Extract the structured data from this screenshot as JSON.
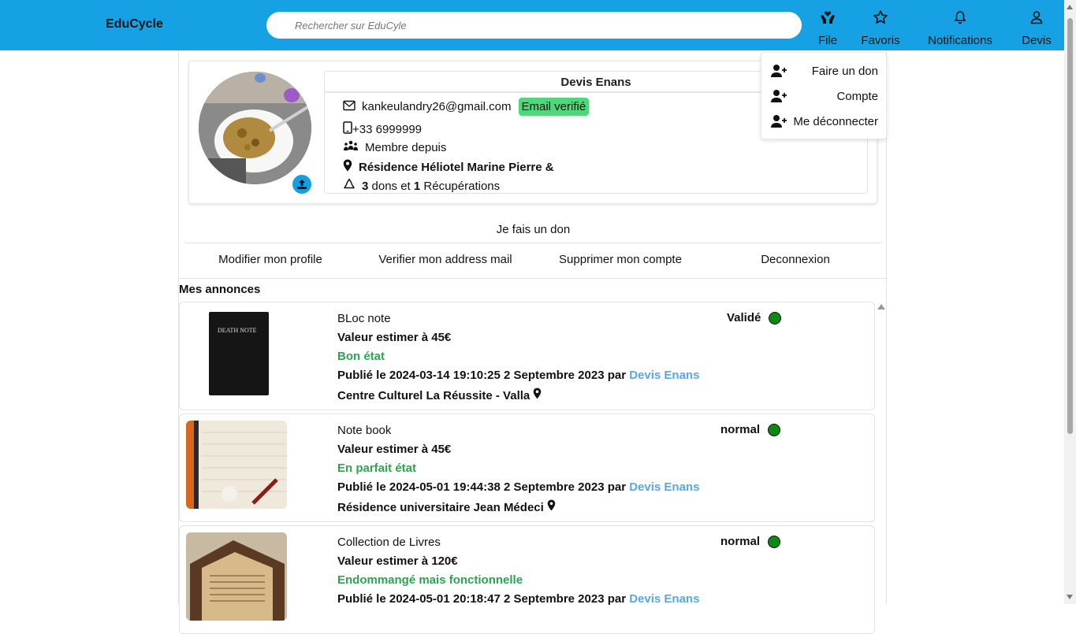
{
  "header": {
    "brand": "EduCycle",
    "search_placeholder": "Rechercher sur EduCyle",
    "nav": [
      {
        "label": "File",
        "icon": "hands-heart-icon"
      },
      {
        "label": "Favoris",
        "icon": "star-icon"
      },
      {
        "label": "Notifications",
        "icon": "bell-icon"
      },
      {
        "label": "Devis",
        "icon": "user-icon"
      }
    ]
  },
  "dropdown": {
    "items": [
      {
        "label": "Faire un don",
        "icon": "user-plus-icon"
      },
      {
        "label": "Compte",
        "icon": "user-plus-icon"
      },
      {
        "label": "Me déconnecter",
        "icon": "user-plus-icon"
      }
    ]
  },
  "profile": {
    "name": "Devis Enans",
    "email": "kankeulandry26@gmail.com",
    "email_status": "Email verifié",
    "phone": "+33  6999999",
    "member_since": "Membre depuis",
    "address": "Résidence Héliotel Marine Pierre &",
    "dons_count": "3",
    "dons_text": " dons et ",
    "recup_count": "1",
    "recup_text": " Récupérations"
  },
  "main_button": "Je fais un don",
  "actions": [
    "Modifier mon profile",
    "Verifier mon address mail",
    "Supprimer mon compte",
    "Deconnexion"
  ],
  "annonces_title": "Mes annonces",
  "annonces": [
    {
      "title": "BLoc note",
      "value": "Valeur estimer à 45€",
      "condition": "Bon état",
      "published_prefix": "Publié le 2024-03-14 19:10:25 2 Septembre 2023 par ",
      "author": "Devis Enans",
      "location": "Centre Culturel La Réussite - Valla",
      "status": "Validé",
      "status_color": "#0a8a12"
    },
    {
      "title": "Note book",
      "value": "Valeur estimer à 45€",
      "condition": "En parfait état",
      "published_prefix": "Publié le 2024-05-01 19:44:38 2 Septembre 2023 par ",
      "author": "Devis Enans",
      "location": "Résidence universitaire Jean Médeci",
      "status": "normal",
      "status_color": "#0a8a12"
    },
    {
      "title": "Collection de Livres",
      "value": "Valeur estimer à 120€",
      "condition": "Endommangé mais fonctionnelle",
      "published_prefix": "Publié le 2024-05-01 20:18:47 2 Septembre 2023 par ",
      "author": "Devis Enans",
      "location": "",
      "status": "normal",
      "status_color": "#0a8a12"
    }
  ],
  "colors": {
    "header_bg": "#15a1e4",
    "verified_bg": "#4fd779",
    "condition_green": "#2da34f",
    "author_blue": "#5aa6e8"
  }
}
